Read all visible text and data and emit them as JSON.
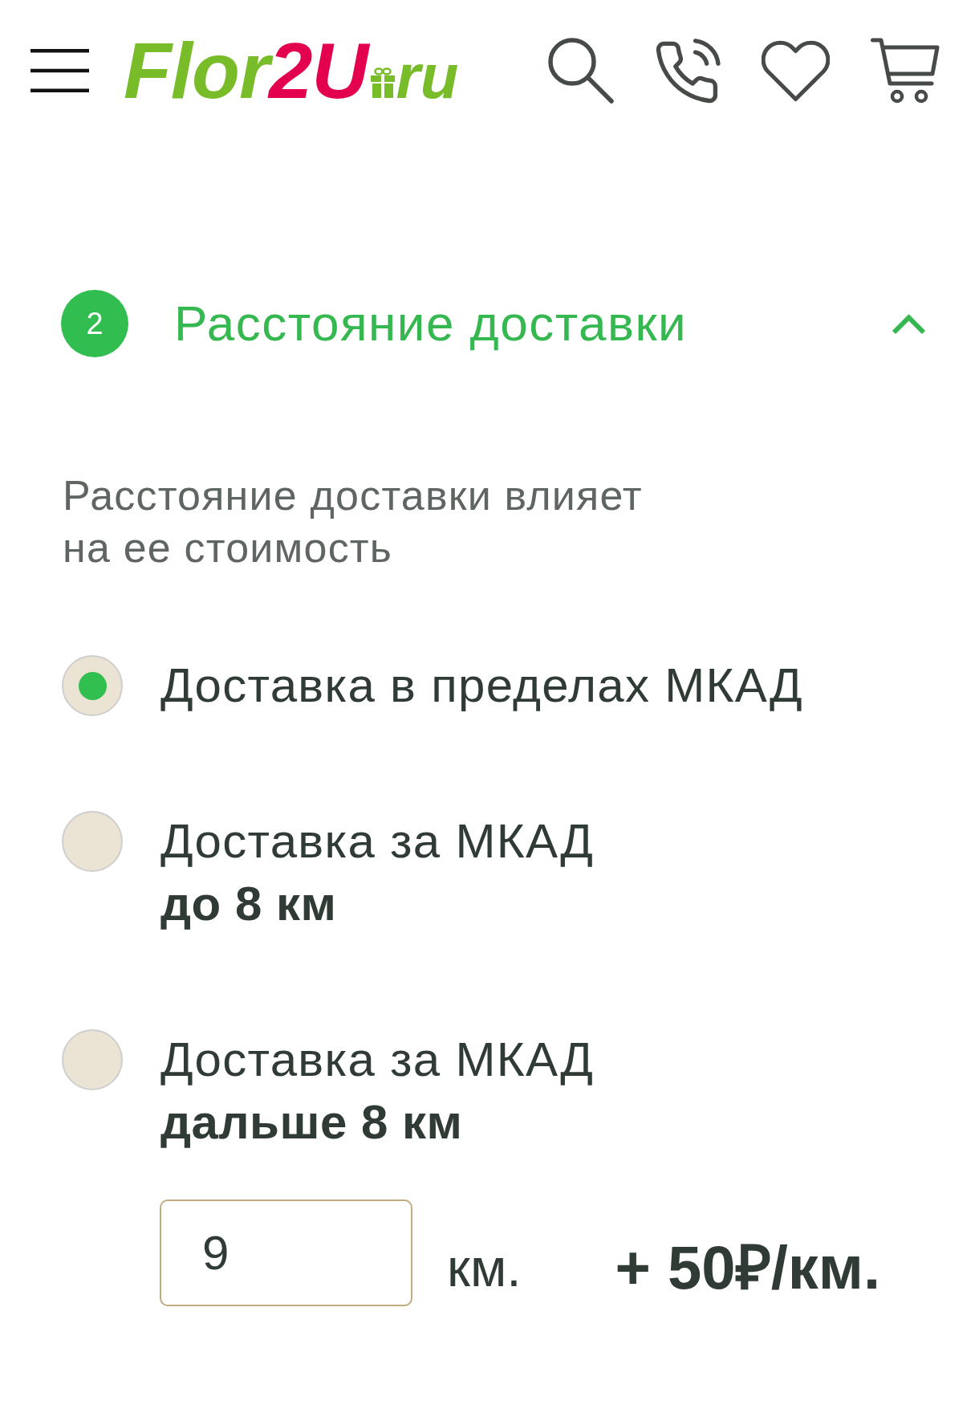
{
  "header": {
    "logo": {
      "parts": [
        {
          "text": "Flor",
          "color": "#79bc2a"
        },
        {
          "text": "2U",
          "color": "#e3004f"
        }
      ],
      "domain": "ru"
    }
  },
  "section": {
    "step": "2",
    "title": "Расстояние доставки",
    "expanded": true,
    "description": "Расстояние доставки влияет на ее стоимость",
    "options": [
      {
        "label": "Доставка в пределах МКАД",
        "selected": true
      },
      {
        "label": "Доставка за МКАД",
        "detail": "до 8 км",
        "selected": false
      },
      {
        "label": "Доставка за МКАД",
        "detail": "дальше 8 км",
        "selected": false
      }
    ],
    "distance": {
      "value": "9",
      "unit": "км.",
      "rate": "+ 50₽/км."
    }
  }
}
